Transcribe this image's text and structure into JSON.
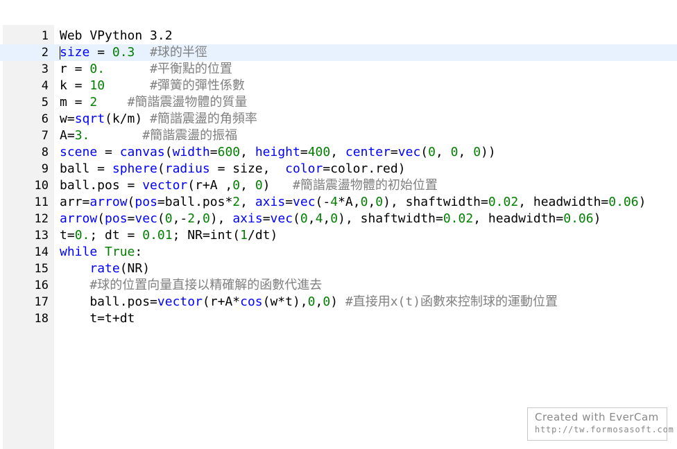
{
  "editor": {
    "lines": [
      {
        "n": "1",
        "tokens": [
          [
            "tx",
            "Web VPython 3.2"
          ]
        ]
      },
      {
        "n": "2",
        "tokens": [
          [
            "kw",
            "size"
          ],
          [
            "op",
            " = "
          ],
          [
            "num",
            "0.3"
          ],
          [
            "op",
            "  "
          ],
          [
            "cm",
            "#球的半徑"
          ]
        ]
      },
      {
        "n": "3",
        "tokens": [
          [
            "tx",
            "r = "
          ],
          [
            "num",
            "0."
          ],
          [
            "op",
            "      "
          ],
          [
            "cm",
            "#平衡點的位置"
          ]
        ]
      },
      {
        "n": "4",
        "tokens": [
          [
            "tx",
            "k = "
          ],
          [
            "num",
            "10"
          ],
          [
            "op",
            "      "
          ],
          [
            "cm",
            "#彈簧的彈性係數"
          ]
        ]
      },
      {
        "n": "5",
        "tokens": [
          [
            "tx",
            "m = "
          ],
          [
            "num",
            "2"
          ],
          [
            "op",
            "    "
          ],
          [
            "cm",
            "#簡諧震盪物體的質量"
          ]
        ]
      },
      {
        "n": "6",
        "tokens": [
          [
            "tx",
            "w="
          ],
          [
            "fn",
            "sqrt"
          ],
          [
            "tx",
            "(k/m) "
          ],
          [
            "cm",
            "#簡諧震盪的角頻率"
          ]
        ]
      },
      {
        "n": "7",
        "tokens": [
          [
            "tx",
            "A="
          ],
          [
            "num",
            "3."
          ],
          [
            "op",
            "       "
          ],
          [
            "cm",
            "#簡諧震盪的振福"
          ]
        ]
      },
      {
        "n": "8",
        "tokens": [
          [
            "kw",
            "scene"
          ],
          [
            "op",
            " = "
          ],
          [
            "fn",
            "canvas"
          ],
          [
            "tx",
            "("
          ],
          [
            "kw",
            "width"
          ],
          [
            "op",
            "="
          ],
          [
            "num",
            "600"
          ],
          [
            "tx",
            ", "
          ],
          [
            "kw",
            "height"
          ],
          [
            "op",
            "="
          ],
          [
            "num",
            "400"
          ],
          [
            "tx",
            ", "
          ],
          [
            "kw",
            "center"
          ],
          [
            "op",
            "="
          ],
          [
            "fn",
            "vec"
          ],
          [
            "tx",
            "("
          ],
          [
            "num",
            "0"
          ],
          [
            "tx",
            ", "
          ],
          [
            "num",
            "0"
          ],
          [
            "tx",
            ", "
          ],
          [
            "num",
            "0"
          ],
          [
            "tx",
            "))"
          ]
        ]
      },
      {
        "n": "9",
        "tokens": [
          [
            "tx",
            "ball = "
          ],
          [
            "fn",
            "sphere"
          ],
          [
            "tx",
            "("
          ],
          [
            "kw",
            "radius"
          ],
          [
            "op",
            " = "
          ],
          [
            "tx",
            "size,  "
          ],
          [
            "kw",
            "color"
          ],
          [
            "op",
            "="
          ],
          [
            "tx",
            "color.red)"
          ]
        ]
      },
      {
        "n": "10",
        "tokens": [
          [
            "tx",
            "ball.pos = "
          ],
          [
            "fn",
            "vector"
          ],
          [
            "tx",
            "(r+A ,"
          ],
          [
            "num",
            "0"
          ],
          [
            "tx",
            ", "
          ],
          [
            "num",
            "0"
          ],
          [
            "tx",
            ")   "
          ],
          [
            "cm",
            "#簡諧震盪物體的初始位置"
          ]
        ]
      },
      {
        "n": "11",
        "tokens": [
          [
            "tx",
            "arr="
          ],
          [
            "fn",
            "arrow"
          ],
          [
            "tx",
            "("
          ],
          [
            "kw",
            "pos"
          ],
          [
            "op",
            "="
          ],
          [
            "tx",
            "ball.pos*"
          ],
          [
            "num",
            "2"
          ],
          [
            "tx",
            ", "
          ],
          [
            "kw",
            "axis"
          ],
          [
            "op",
            "="
          ],
          [
            "fn",
            "vec"
          ],
          [
            "tx",
            "(-"
          ],
          [
            "num",
            "4"
          ],
          [
            "tx",
            "*A,"
          ],
          [
            "num",
            "0"
          ],
          [
            "tx",
            ","
          ],
          [
            "num",
            "0"
          ],
          [
            "tx",
            "), shaftwidth="
          ],
          [
            "num",
            "0.02"
          ],
          [
            "tx",
            ", headwidth="
          ],
          [
            "num",
            "0.06"
          ],
          [
            "tx",
            ")"
          ]
        ]
      },
      {
        "n": "12",
        "tokens": [
          [
            "fn",
            "arrow"
          ],
          [
            "tx",
            "("
          ],
          [
            "kw",
            "pos"
          ],
          [
            "op",
            "="
          ],
          [
            "fn",
            "vec"
          ],
          [
            "tx",
            "("
          ],
          [
            "num",
            "0"
          ],
          [
            "tx",
            ",-"
          ],
          [
            "num",
            "2"
          ],
          [
            "tx",
            ","
          ],
          [
            "num",
            "0"
          ],
          [
            "tx",
            "), "
          ],
          [
            "kw",
            "axis"
          ],
          [
            "op",
            "="
          ],
          [
            "fn",
            "vec"
          ],
          [
            "tx",
            "("
          ],
          [
            "num",
            "0"
          ],
          [
            "tx",
            ","
          ],
          [
            "num",
            "4"
          ],
          [
            "tx",
            ","
          ],
          [
            "num",
            "0"
          ],
          [
            "tx",
            "), shaftwidth="
          ],
          [
            "num",
            "0.02"
          ],
          [
            "tx",
            ", headwidth="
          ],
          [
            "num",
            "0.06"
          ],
          [
            "tx",
            ")"
          ]
        ]
      },
      {
        "n": "13",
        "tokens": [
          [
            "tx",
            "t="
          ],
          [
            "num",
            "0."
          ],
          [
            "tx",
            "; dt = "
          ],
          [
            "num",
            "0.01"
          ],
          [
            "tx",
            "; NR=int("
          ],
          [
            "num",
            "1"
          ],
          [
            "tx",
            "/dt)"
          ]
        ]
      },
      {
        "n": "14",
        "tokens": [
          [
            "kw",
            "while"
          ],
          [
            "tx",
            " "
          ],
          [
            "true",
            "True"
          ],
          [
            "tx",
            ":"
          ]
        ]
      },
      {
        "n": "15",
        "tokens": [
          [
            "tx",
            "    "
          ],
          [
            "fn",
            "rate"
          ],
          [
            "tx",
            "(NR)"
          ]
        ]
      },
      {
        "n": "16",
        "tokens": [
          [
            "tx",
            "    "
          ],
          [
            "cm",
            "#球的位置向量直接以精確解的函數代進去"
          ]
        ]
      },
      {
        "n": "17",
        "tokens": [
          [
            "tx",
            "    ball.pos="
          ],
          [
            "fn",
            "vector"
          ],
          [
            "tx",
            "(r+A*"
          ],
          [
            "fn",
            "cos"
          ],
          [
            "tx",
            "(w*t),"
          ],
          [
            "num",
            "0"
          ],
          [
            "tx",
            ","
          ],
          [
            "num",
            "0"
          ],
          [
            "tx",
            ") "
          ],
          [
            "cm",
            "#直接用x(t)函數來控制球的運動位置"
          ]
        ]
      },
      {
        "n": "18",
        "tokens": [
          [
            "tx",
            "    t=t+dt"
          ]
        ]
      }
    ],
    "active_line": 2
  },
  "watermark": {
    "line1": "Created  with  EverCam",
    "line2": "http://tw.formosasoft.com"
  }
}
